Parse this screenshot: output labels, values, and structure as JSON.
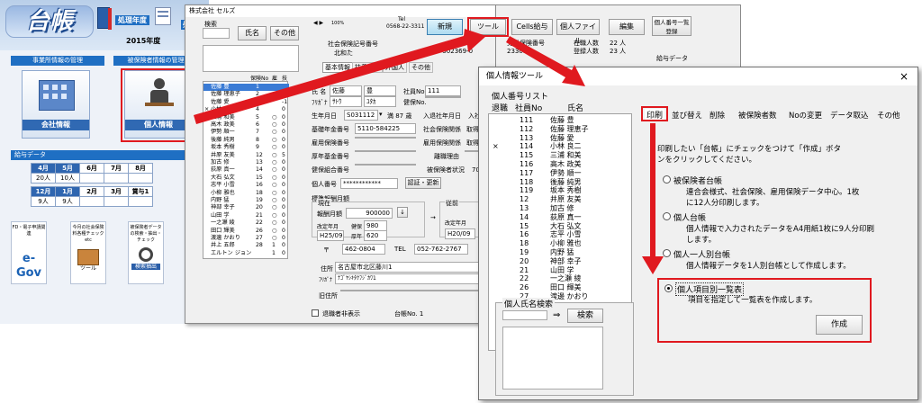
{
  "menu": {
    "logo": "台帳",
    "fiscal_year_label": "処理年度",
    "fiscal_year": "2015年度",
    "processing_label": "処理",
    "section_office": "事業所情報の管理",
    "section_insured": "被保険者情報の管理",
    "office_info": "会社情報",
    "personal_info": "個人情報",
    "payroll_header": "給与データ",
    "payroll_rows": [
      {
        "months": [
          "4月",
          "5月",
          "6月",
          "7月",
          "8月"
        ],
        "counts": [
          "20人",
          "10人",
          "",
          "",
          ""
        ]
      },
      {
        "months": [
          "12月",
          "1月",
          "2月",
          "3月",
          "賞与1"
        ],
        "counts": [
          "9人",
          "9人",
          "",
          "",
          ""
        ]
      }
    ],
    "tiles": [
      {
        "title": "FD・電子申請関連",
        "caption": "e-Gov"
      },
      {
        "title": "今月の社会保険料各種チェック etc",
        "caption": "ツール"
      },
      {
        "title": "被保険者データの検索・抽出・チェック",
        "caption": "検索抽出"
      }
    ]
  },
  "employee_window": {
    "company": "株式会社 セルズ",
    "search_label": "検索",
    "btn_name": "氏名",
    "btn_other": "その他",
    "list_header": {
      "no": "保険No",
      "kan": "雇",
      "roku": "技"
    },
    "employees": [
      {
        "mark": "",
        "name": "佐藤 豊",
        "no": "1",
        "k": "",
        "r": ""
      },
      {
        "mark": "",
        "name": "佐藤 理恵子",
        "no": "2",
        "k": "",
        "r": "0"
      },
      {
        "mark": "",
        "name": "佐藤 愛",
        "no": "3",
        "k": "",
        "r": "-1"
      },
      {
        "mark": "×",
        "name": "小林 良二",
        "no": "4",
        "k": "",
        "r": "0"
      },
      {
        "mark": "",
        "name": "三浦 和美",
        "no": "5",
        "k": "○",
        "r": "0"
      },
      {
        "mark": "",
        "name": "高木 政美",
        "no": "6",
        "k": "○",
        "r": "0"
      },
      {
        "mark": "",
        "name": "伊勢 順一",
        "no": "7",
        "k": "○",
        "r": "0"
      },
      {
        "mark": "",
        "name": "後藤 純男",
        "no": "8",
        "k": "○",
        "r": "0"
      },
      {
        "mark": "",
        "name": "坂本 秀樹",
        "no": "9",
        "k": "○",
        "r": "0"
      },
      {
        "mark": "",
        "name": "井原 友美",
        "no": "12",
        "k": "○",
        "r": "5"
      },
      {
        "mark": "",
        "name": "加古 修",
        "no": "13",
        "k": "○",
        "r": "0"
      },
      {
        "mark": "",
        "name": "荻原 真一",
        "no": "14",
        "k": "○",
        "r": "0"
      },
      {
        "mark": "",
        "name": "大石 弘文",
        "no": "15",
        "k": "○",
        "r": "0"
      },
      {
        "mark": "",
        "name": "志平 小雪",
        "no": "16",
        "k": "○",
        "r": "0"
      },
      {
        "mark": "",
        "name": "小柳 雅也",
        "no": "18",
        "k": "○",
        "r": "0"
      },
      {
        "mark": "",
        "name": "内野 猛",
        "no": "19",
        "k": "○",
        "r": "0"
      },
      {
        "mark": "",
        "name": "神部 幸子",
        "no": "20",
        "k": "○",
        "r": "0"
      },
      {
        "mark": "",
        "name": "山田 学",
        "no": "21",
        "k": "○",
        "r": "0"
      },
      {
        "mark": "",
        "name": "一之瀬 綾",
        "no": "22",
        "k": "○",
        "r": "0"
      },
      {
        "mark": "",
        "name": "田口 輝美",
        "no": "26",
        "k": "○",
        "r": "0"
      },
      {
        "mark": "",
        "name": "渡邊 かおり",
        "no": "27",
        "k": "○",
        "r": "0"
      },
      {
        "mark": "",
        "name": "井上 五郎",
        "no": "28",
        "k": "1",
        "r": "0"
      },
      {
        "mark": "",
        "name": "エルトン ジョン",
        "no": "",
        "k": "1",
        "r": "0"
      }
    ],
    "nav_zoom": "100%",
    "tel_label": "Tel",
    "tel": "0568-22-3311",
    "btn_new": "新規",
    "btn_tool": "ツール",
    "btn_cells": "Cells給与",
    "btn_file": "個人ファイル",
    "btn_edit": "編集",
    "btn_list": "個人番号一覧登録",
    "social_ins_label": "社会保険記号番号",
    "social_ins_value": "北和た",
    "labor_label": "労働保険番号",
    "labor_value": "23301",
    "emp_ins_value": "2310-502369-0",
    "enrolled_label": "在職人数",
    "enrolled": "22 人",
    "registered_label": "登録人数",
    "registered": "23 人",
    "payroll_data": "給与データ",
    "tabs": [
      "基本情報",
      "扶養家族",
      "外国人",
      "その他"
    ],
    "name_label": "氏 名",
    "last_name": "佐藤",
    "first_name": "豊",
    "kana_label": "ﾌﾘｶﾞﾅ",
    "kana_last": "ｻﾄｳ",
    "kana_first": "ﾕﾀｶ",
    "emp_no_label": "社員No",
    "emp_no": "111",
    "health_no_label": "健保No.",
    "birth_label": "生年月日",
    "birth": "S031112",
    "age": "満 87 歳",
    "join_label": "入退社年月日",
    "join_value": "入社 H",
    "pension_label": "基礎年金番号",
    "pension": "5110-584225",
    "social_rel_label": "社会保険関係",
    "acquired": "取得日",
    "emp_ins_label": "雇用保険番号",
    "emp_rel_label": "雇用保険関係",
    "kosei_label": "厚年基金番号",
    "leave_reason_label": "離職理由",
    "kenpo_label": "健保組合番号",
    "insured_status_label": "被保険者状況",
    "insured_status": "70歳",
    "my_number_label": "個人番号",
    "my_number": "************",
    "btn_auth": "認証・更新",
    "std_label": "標準報酬月額",
    "current_label": "現在",
    "monthly_label": "報酬月額",
    "monthly": "900000",
    "revision_label": "改定年月",
    "health_label": "健保",
    "health_val": "980",
    "revision": "H25/09",
    "pension_short": "厚年",
    "pension_val": "620",
    "prev_label": "従前",
    "prev_revision_label": "改定年月",
    "prev_health_label": "健保",
    "prev_revision": "H20/09",
    "prev_pension_label": "厚年",
    "zip_mark": "〒",
    "zip": "462-0804",
    "tel2_label": "TEL",
    "tel2": "052-762-2767",
    "addr_label": "住所",
    "addr": "名古屋市北区藤川1",
    "addr_kana": "ﾅｺﾞﾔｼｷﾀｸﾌｼﾞｶﾜ1",
    "old_addr_label": "旧住所",
    "retired_label": "退職者非表示",
    "ledger_no": "台帳No. 1"
  },
  "dialog": {
    "title": "個人情報ツール",
    "close": "×",
    "list_title": "個人番号リスト",
    "col_retired": "退職",
    "col_empno": "社員No",
    "col_name": "氏名",
    "rows": [
      {
        "mark": "",
        "no": "111",
        "name": "佐藤 豊"
      },
      {
        "mark": "",
        "no": "112",
        "name": "佐藤 理恵子"
      },
      {
        "mark": "",
        "no": "113",
        "name": "佐藤 愛"
      },
      {
        "mark": "×",
        "no": "114",
        "name": "小林 良二"
      },
      {
        "mark": "",
        "no": "115",
        "name": "三浦 和美"
      },
      {
        "mark": "",
        "no": "116",
        "name": "高木 政美"
      },
      {
        "mark": "",
        "no": "117",
        "name": "伊勢 順一"
      },
      {
        "mark": "",
        "no": "118",
        "name": "後藤 純男"
      },
      {
        "mark": "",
        "no": "119",
        "name": "坂本 秀樹"
      },
      {
        "mark": "",
        "no": "12",
        "name": "井原 友美"
      },
      {
        "mark": "",
        "no": "13",
        "name": "加古 修"
      },
      {
        "mark": "",
        "no": "14",
        "name": "荻原 真一"
      },
      {
        "mark": "",
        "no": "15",
        "name": "大石 弘文"
      },
      {
        "mark": "",
        "no": "16",
        "name": "志平 小雪"
      },
      {
        "mark": "",
        "no": "18",
        "name": "小柳 雅也"
      },
      {
        "mark": "",
        "no": "19",
        "name": "内野 猛"
      },
      {
        "mark": "",
        "no": "20",
        "name": "神部 幸子"
      },
      {
        "mark": "",
        "no": "21",
        "name": "山田 学"
      },
      {
        "mark": "",
        "no": "22",
        "name": "一之瀬 綾"
      },
      {
        "mark": "",
        "no": "26",
        "name": "田口 輝美"
      },
      {
        "mark": "",
        "no": "27",
        "name": "渡邊 かおり"
      }
    ],
    "search_title": "個人氏名検索",
    "arrow": "⇒",
    "btn_search": "検索",
    "tabs": [
      "印刷",
      "並び替え",
      "削除",
      "被保険者数",
      "Noの変更",
      "データ取込",
      "その他"
    ],
    "instruction": "印刷したい「台帳」にチェックをつけて「作成」ボタンをクリックしてください。",
    "options": [
      {
        "label": "被保険者台帳",
        "desc": "連合会様式、社会保険、雇用保険データ中心。1枚に12人分印刷します。",
        "checked": false
      },
      {
        "label": "個人台帳",
        "desc": "個人情報で入力されたデータをA4用紙1枚に9人分印刷します。",
        "checked": false
      },
      {
        "label": "個人一人別台帳",
        "desc": "個人情報データを1人別台帳として作成します。",
        "checked": false
      },
      {
        "label": "個人項目別一覧表",
        "desc": "項目を指定して一覧表を作成します。",
        "checked": true
      }
    ],
    "btn_create": "作成"
  },
  "colors": {
    "highlight": "#e0191f",
    "header_blue": "#1f6fc3",
    "selection": "#3a7bd5"
  }
}
